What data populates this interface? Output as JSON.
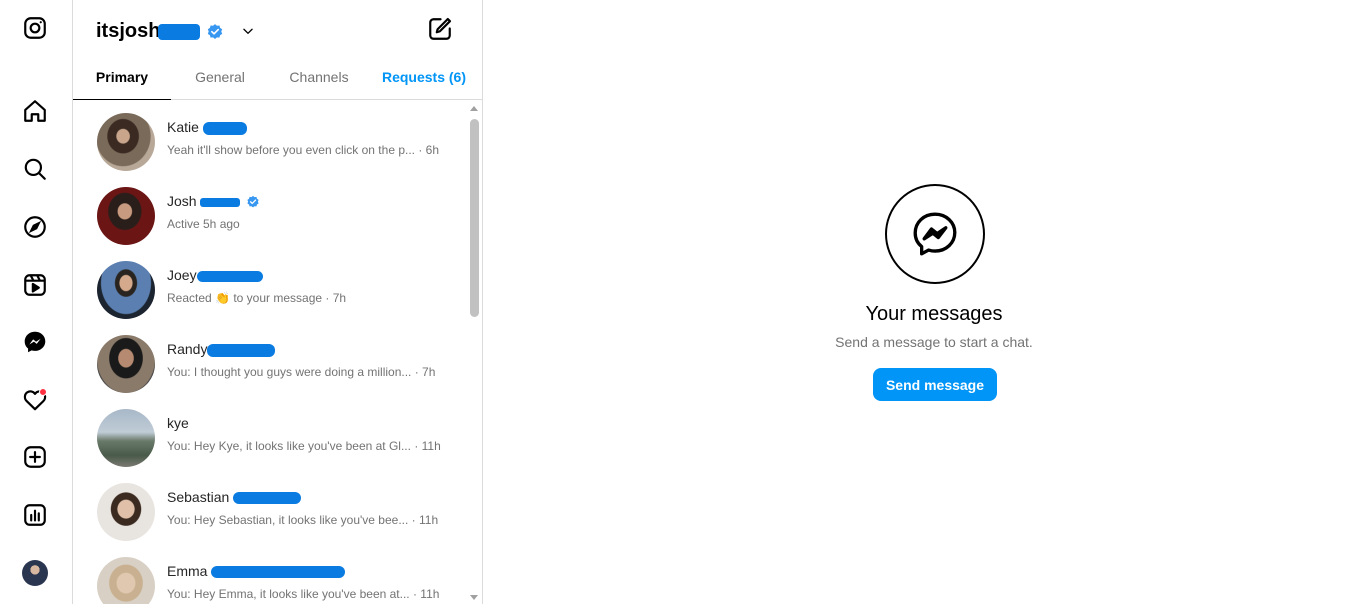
{
  "rail": {
    "icons": [
      "instagram-icon",
      "home-icon",
      "search-icon",
      "explore-icon",
      "reels-icon",
      "messenger-icon",
      "heart-icon",
      "create-icon",
      "dashboard-icon",
      "profile-avatar"
    ]
  },
  "header": {
    "username": "itsjosh",
    "verified": true
  },
  "tabs": [
    {
      "label": "Primary",
      "active": true
    },
    {
      "label": "General",
      "active": false
    },
    {
      "label": "Channels",
      "active": false
    },
    {
      "label": "Requests (6)",
      "active": false
    }
  ],
  "conversations": [
    {
      "name": "Katie",
      "preview": "Yeah it'll show before you even click on the p... · 6h"
    },
    {
      "name": "Josh",
      "preview": "Active 5h ago",
      "verified": true
    },
    {
      "name": "Joey",
      "preview_before": "Reacted",
      "preview_after": "to your message · 7h"
    },
    {
      "name": "Randy",
      "preview": "You: I thought you guys were doing a million... · 7h"
    },
    {
      "name": "kye",
      "preview": "You: Hey Kye, it looks like you've been at Gl... · 11h"
    },
    {
      "name": "Sebastian",
      "preview": "You: Hey Sebastian, it looks like you've bee... · 11h"
    },
    {
      "name": "Emma",
      "preview": "You: Hey Emma, it looks like you've been at... · 11h"
    }
  ],
  "empty_state": {
    "title": "Your messages",
    "subtitle": "Send a message to start a chat.",
    "button": "Send message"
  },
  "colors": {
    "accent": "#0095f6",
    "border": "#dbdbdb",
    "muted_text": "#737373",
    "notification_dot": "#ff3040",
    "redaction": "#0a7be0"
  }
}
